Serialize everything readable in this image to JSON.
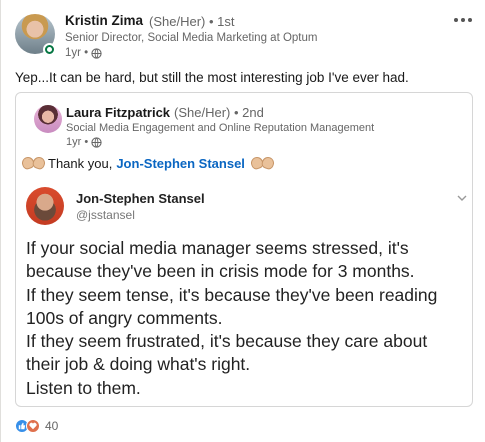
{
  "post": {
    "author": {
      "name": "Kristin Zima",
      "meta": "(She/Her) • 1st",
      "title": "Senior Director, Social Media Marketing at Optum",
      "time": "1yr •"
    },
    "text": "Yep...It can be hard, but still the most interesting job I've ever had."
  },
  "quote": {
    "author": {
      "name": "Laura Fitzpatrick",
      "meta": "(She/Her) • 2nd",
      "title": "Social Media Engagement and Online Reputation Management",
      "time": "1yr •"
    },
    "thanks_text": "Thank you,",
    "mention": "Jon-Stephen Stansel",
    "tweet": {
      "name": "Jon-Stephen Stansel",
      "handle": "@jsstansel",
      "lines": [
        "If your social media manager seems stressed, it's",
        "because they've been in crisis mode for 3 months.",
        "If they seem tense, it's because they've been reading",
        "100s of angry comments.",
        "If they seem frustrated, it's because they care about",
        "their job & doing what's right.",
        "Listen to them."
      ]
    }
  },
  "reactions": {
    "count": "40",
    "icons": [
      "like-icon",
      "love-icon"
    ]
  },
  "colors": {
    "link": "#0a66c2",
    "online": "#057642",
    "like": "#378fe9",
    "love": "#df704d"
  }
}
